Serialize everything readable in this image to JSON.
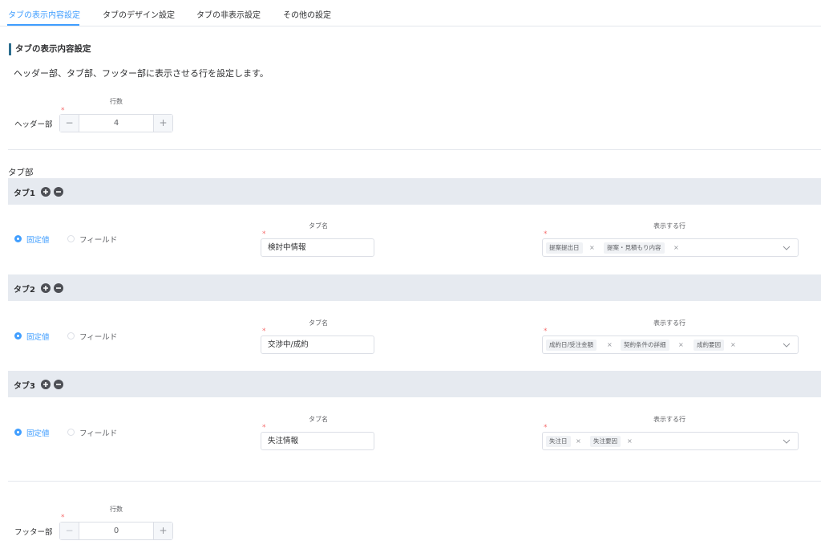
{
  "tabs": [
    "タブの表示内容設定",
    "タブのデザイン設定",
    "タブの非表示設定",
    "その他の設定"
  ],
  "section_title": "タブの表示内容設定",
  "description": "ヘッダー部、タブ部、フッター部に表示させる行を設定します。",
  "row_count_label": "行数",
  "header": {
    "label": "ヘッダー部",
    "value": "4",
    "minus": "−",
    "plus": "+"
  },
  "tab_section_title": "タブ部",
  "tab_name_label": "タブ名",
  "display_rows_label": "表示する行",
  "radio_fixed": "固定値",
  "radio_field": "フィールド",
  "tab_items": [
    {
      "label": "タブ1",
      "name": "検討中情報",
      "chips": [
        "提案提出日",
        "提案・見積もり内容"
      ]
    },
    {
      "label": "タブ2",
      "name": "交渉中/成約",
      "chips": [
        "成約日/受注金額",
        "契約条件の詳細",
        "成約要因"
      ]
    },
    {
      "label": "タブ3",
      "name": "失注情報",
      "chips": [
        "失注日",
        "失注要因"
      ]
    }
  ],
  "footer": {
    "label": "フッター部",
    "value": "0",
    "minus": "−",
    "plus": "+"
  },
  "required_mark": "*",
  "chip_remove": "×",
  "colors": {
    "accent": "#409eff",
    "required": "#f56c6c",
    "bar_bg": "#e6eaf0",
    "section_marker": "#2d6e8f"
  }
}
